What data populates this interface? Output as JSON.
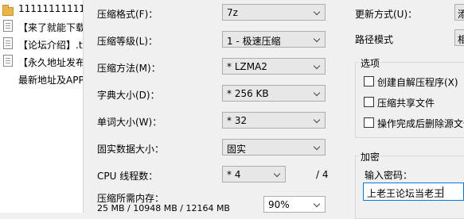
{
  "files": [
    {
      "name": "11111111111",
      "icon": "folder-icon"
    },
    {
      "name": "【来了就能下载",
      "icon": "document-icon"
    },
    {
      "name": "【论坛介绍】.t",
      "icon": "document-icon"
    },
    {
      "name": "【永久地址发布",
      "icon": "document-icon"
    },
    {
      "name": "最新地址及APP",
      "icon": "document-icon"
    }
  ],
  "form": {
    "format_label": "压缩格式(F)：",
    "format_value": "7z",
    "level_label": "压缩等级(L)：",
    "level_value": "1 - 极速压缩",
    "method_label": "压缩方法(M)：",
    "method_value": "* LZMA2",
    "dict_label": "字典大小(D)：",
    "dict_value": "* 256 KB",
    "word_label": "单词大小(W)：",
    "word_value": "* 32",
    "solid_label": "固实数据大小：",
    "solid_value": "固实",
    "threads_label": "CPU 线程数：",
    "threads_value": "* 4",
    "threads_max": "/ 4",
    "memory_label": "压缩所需内存：",
    "memory_info": "25 MB / 10948 MB / 12164 MB",
    "memory_pct": "90%"
  },
  "right": {
    "update_label": "更新方式(U)：",
    "update_value": "添",
    "path_label": "路径模式",
    "path_value": "相",
    "options_title": "选项",
    "opt_sfx": "创建自解压程序(X)",
    "opt_shared": "压缩共享文件",
    "opt_delete": "操作完成后删除源文件",
    "encryption_title": "加密",
    "password_label": "输入密码：",
    "password_value": "上老王论坛当老王"
  }
}
